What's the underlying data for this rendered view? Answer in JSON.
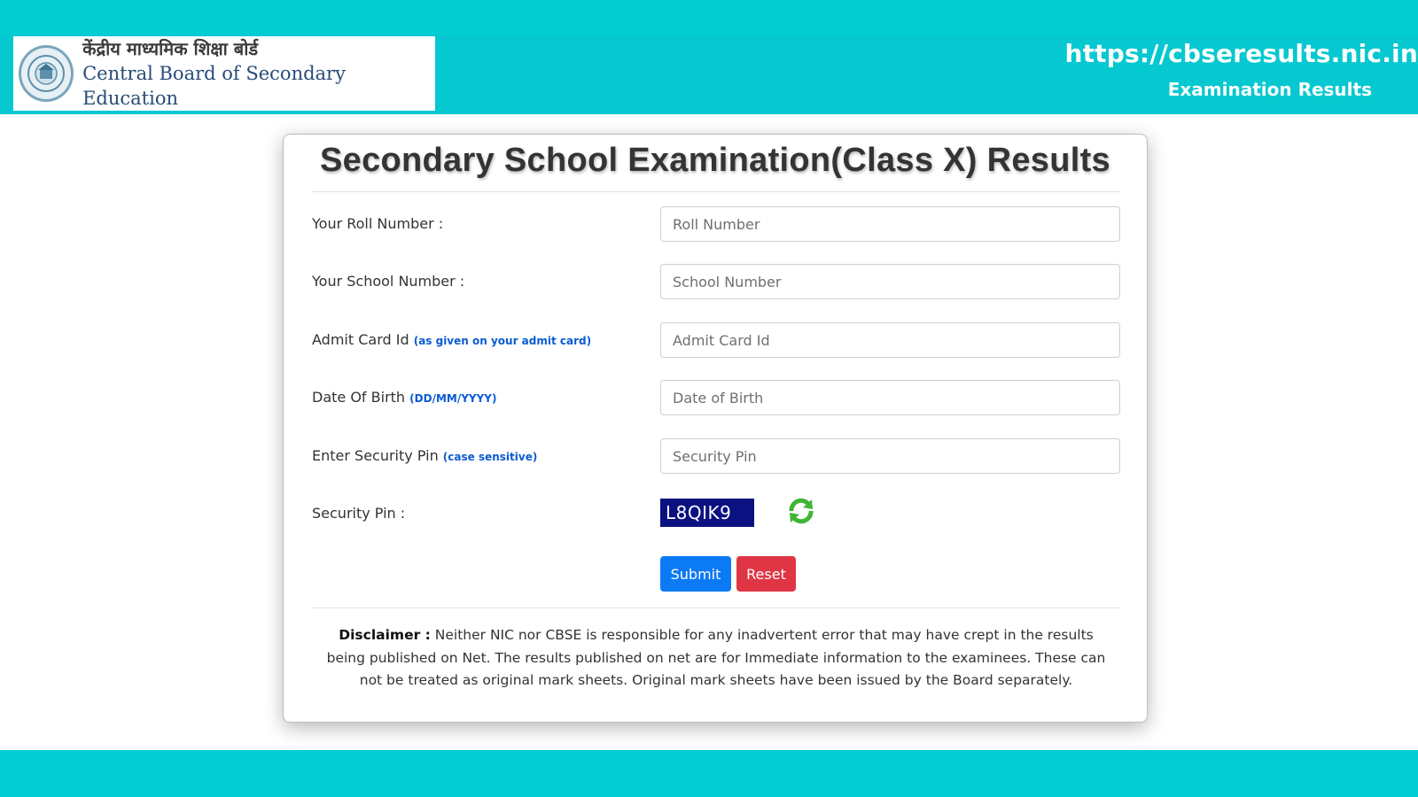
{
  "colors": {
    "band": "#06c8d0",
    "submit": "#0d7af5",
    "reset": "#df3545",
    "captcha_bg": "#0b1180",
    "hint": "#0a5bd3"
  },
  "header": {
    "logo_hindi": "केंद्रीय माध्यमिक शिक्षा बोर्ड",
    "logo_english": "Central Board of Secondary Education",
    "site_url": "https://cbseresults.nic.in",
    "site_subtitle": "Examination Results"
  },
  "form": {
    "title": "Secondary School Examination(Class X) Results",
    "roll": {
      "label": "Your Roll Number :",
      "placeholder": "Roll Number"
    },
    "school": {
      "label": "Your School Number :",
      "placeholder": "School Number"
    },
    "admit": {
      "label": "Admit Card Id",
      "hint": "(as given on your admit card)",
      "placeholder": "Admit Card Id"
    },
    "dob": {
      "label": "Date Of Birth",
      "hint": "(DD/MM/YYYY)",
      "placeholder": "Date of Birth"
    },
    "pin_entry": {
      "label": "Enter Security Pin",
      "hint": "(case sensitive)",
      "placeholder": "Security Pin"
    },
    "captcha": {
      "label": "Security Pin :",
      "code": "L8QIK9",
      "refresh_icon": "refresh-icon"
    },
    "buttons": {
      "submit": "Submit",
      "reset": "Reset"
    }
  },
  "disclaimer": {
    "heading": "Disclaimer :",
    "text": "Neither NIC nor CBSE is responsible for any inadvertent error that may have crept in the results being published on Net. The results published on net are for Immediate information to the examinees. These can not be treated as original mark sheets. Original mark sheets have been issued by the Board separately."
  }
}
